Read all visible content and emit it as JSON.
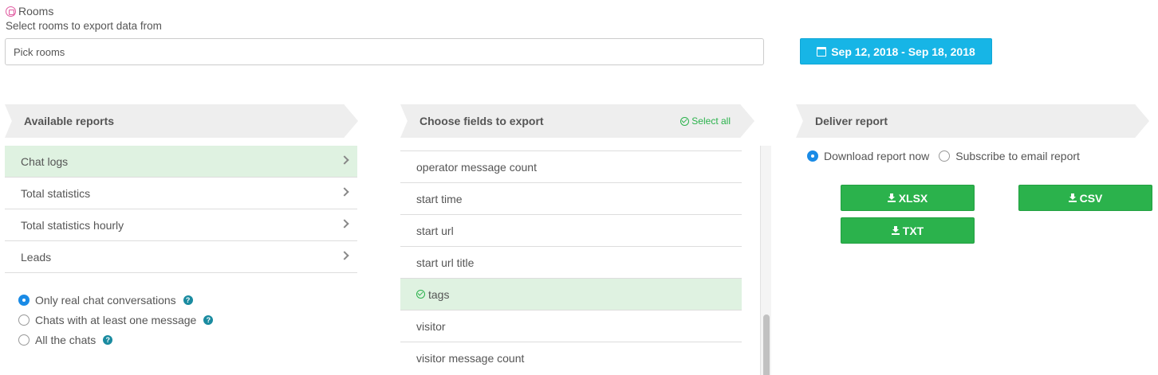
{
  "rooms": {
    "title": "Rooms",
    "subtitle": "Select rooms to export data from",
    "placeholder": "Pick rooms"
  },
  "date_range": {
    "label": "Sep 12, 2018 - Sep 18, 2018",
    "icon": "calendar-icon"
  },
  "reports": {
    "header": "Available reports",
    "items": [
      {
        "label": "Chat logs",
        "active": true
      },
      {
        "label": "Total statistics",
        "active": false
      },
      {
        "label": "Total statistics hourly",
        "active": false
      },
      {
        "label": "Leads",
        "active": false
      }
    ],
    "filters": [
      {
        "label": "Only real chat conversations",
        "checked": true
      },
      {
        "label": "Chats with at least one message",
        "checked": false
      },
      {
        "label": "All the chats",
        "checked": false
      }
    ]
  },
  "fields": {
    "header": "Choose fields to export",
    "select_all": "Select all",
    "items": [
      {
        "label": "operator message count",
        "selected": false
      },
      {
        "label": "start time",
        "selected": false
      },
      {
        "label": "start url",
        "selected": false
      },
      {
        "label": "start url title",
        "selected": false
      },
      {
        "label": "tags",
        "selected": true
      },
      {
        "label": "visitor",
        "selected": false
      },
      {
        "label": "visitor message count",
        "selected": false
      }
    ]
  },
  "deliver": {
    "header": "Deliver report",
    "options": [
      {
        "label": "Download report now",
        "checked": true
      },
      {
        "label": "Subscribe to email report",
        "checked": false
      }
    ],
    "buttons": {
      "xlsx": "XLSX",
      "csv": "CSV",
      "txt": "TXT"
    }
  },
  "colors": {
    "accent_blue": "#17b5e6",
    "green": "#2bb24c",
    "selected_bg": "#dff2e1"
  }
}
